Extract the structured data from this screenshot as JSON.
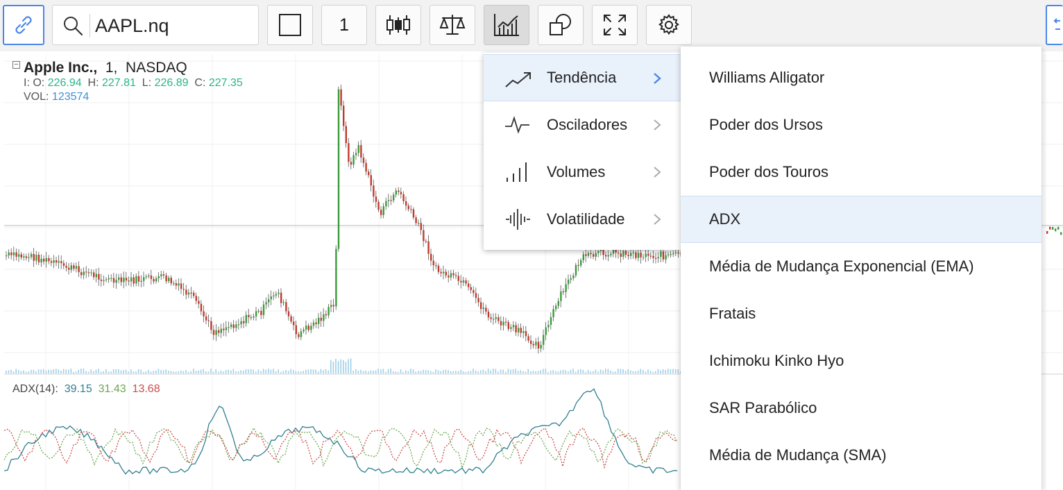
{
  "toolbar": {
    "symbol": "AAPL.nq",
    "interval": "1"
  },
  "legend": {
    "name": "Apple Inc.,",
    "interval": "1,",
    "exchange": "NASDAQ",
    "open_label": "I: O:",
    "open": "226.94",
    "high_label": "H:",
    "high": "227.81",
    "low_label": "L:",
    "low": "226.89",
    "close_label": "C:",
    "close": "227.35",
    "vol_label": "VOL:",
    "vol": "123574"
  },
  "indicator": {
    "label": "ADX(14):",
    "adx": "39.15",
    "plus_di": "31.43",
    "minus_di": "13.68",
    "colors": {
      "adx": "#2f7f8f",
      "plus": "#6aa84f",
      "minus": "#cc4b4b"
    }
  },
  "menu_categories": [
    {
      "label": "Tendência",
      "icon": "trend-icon",
      "selected": true
    },
    {
      "label": "Osciladores",
      "icon": "oscillator-icon",
      "selected": false
    },
    {
      "label": "Volumes",
      "icon": "volume-icon",
      "selected": false
    },
    {
      "label": "Volatilidade",
      "icon": "volatility-icon",
      "selected": false
    }
  ],
  "menu_indicators": [
    {
      "label": "Williams Alligator",
      "selected": false
    },
    {
      "label": "Poder dos Ursos",
      "selected": false
    },
    {
      "label": "Poder dos Touros",
      "selected": false
    },
    {
      "label": "ADX",
      "selected": true
    },
    {
      "label": "Média de Mudança Exponencial (EMA)",
      "selected": false
    },
    {
      "label": "Fratais",
      "selected": false
    },
    {
      "label": "Ichimoku Kinko Hyo",
      "selected": false
    },
    {
      "label": "SAR Parabólico",
      "selected": false
    },
    {
      "label": "Média de Mudança (SMA)",
      "selected": false
    }
  ],
  "colors": {
    "accent": "#4a86e8",
    "up": "#3a9a3a",
    "down": "#c0392b",
    "selected_bg": "#e9f1fb"
  }
}
